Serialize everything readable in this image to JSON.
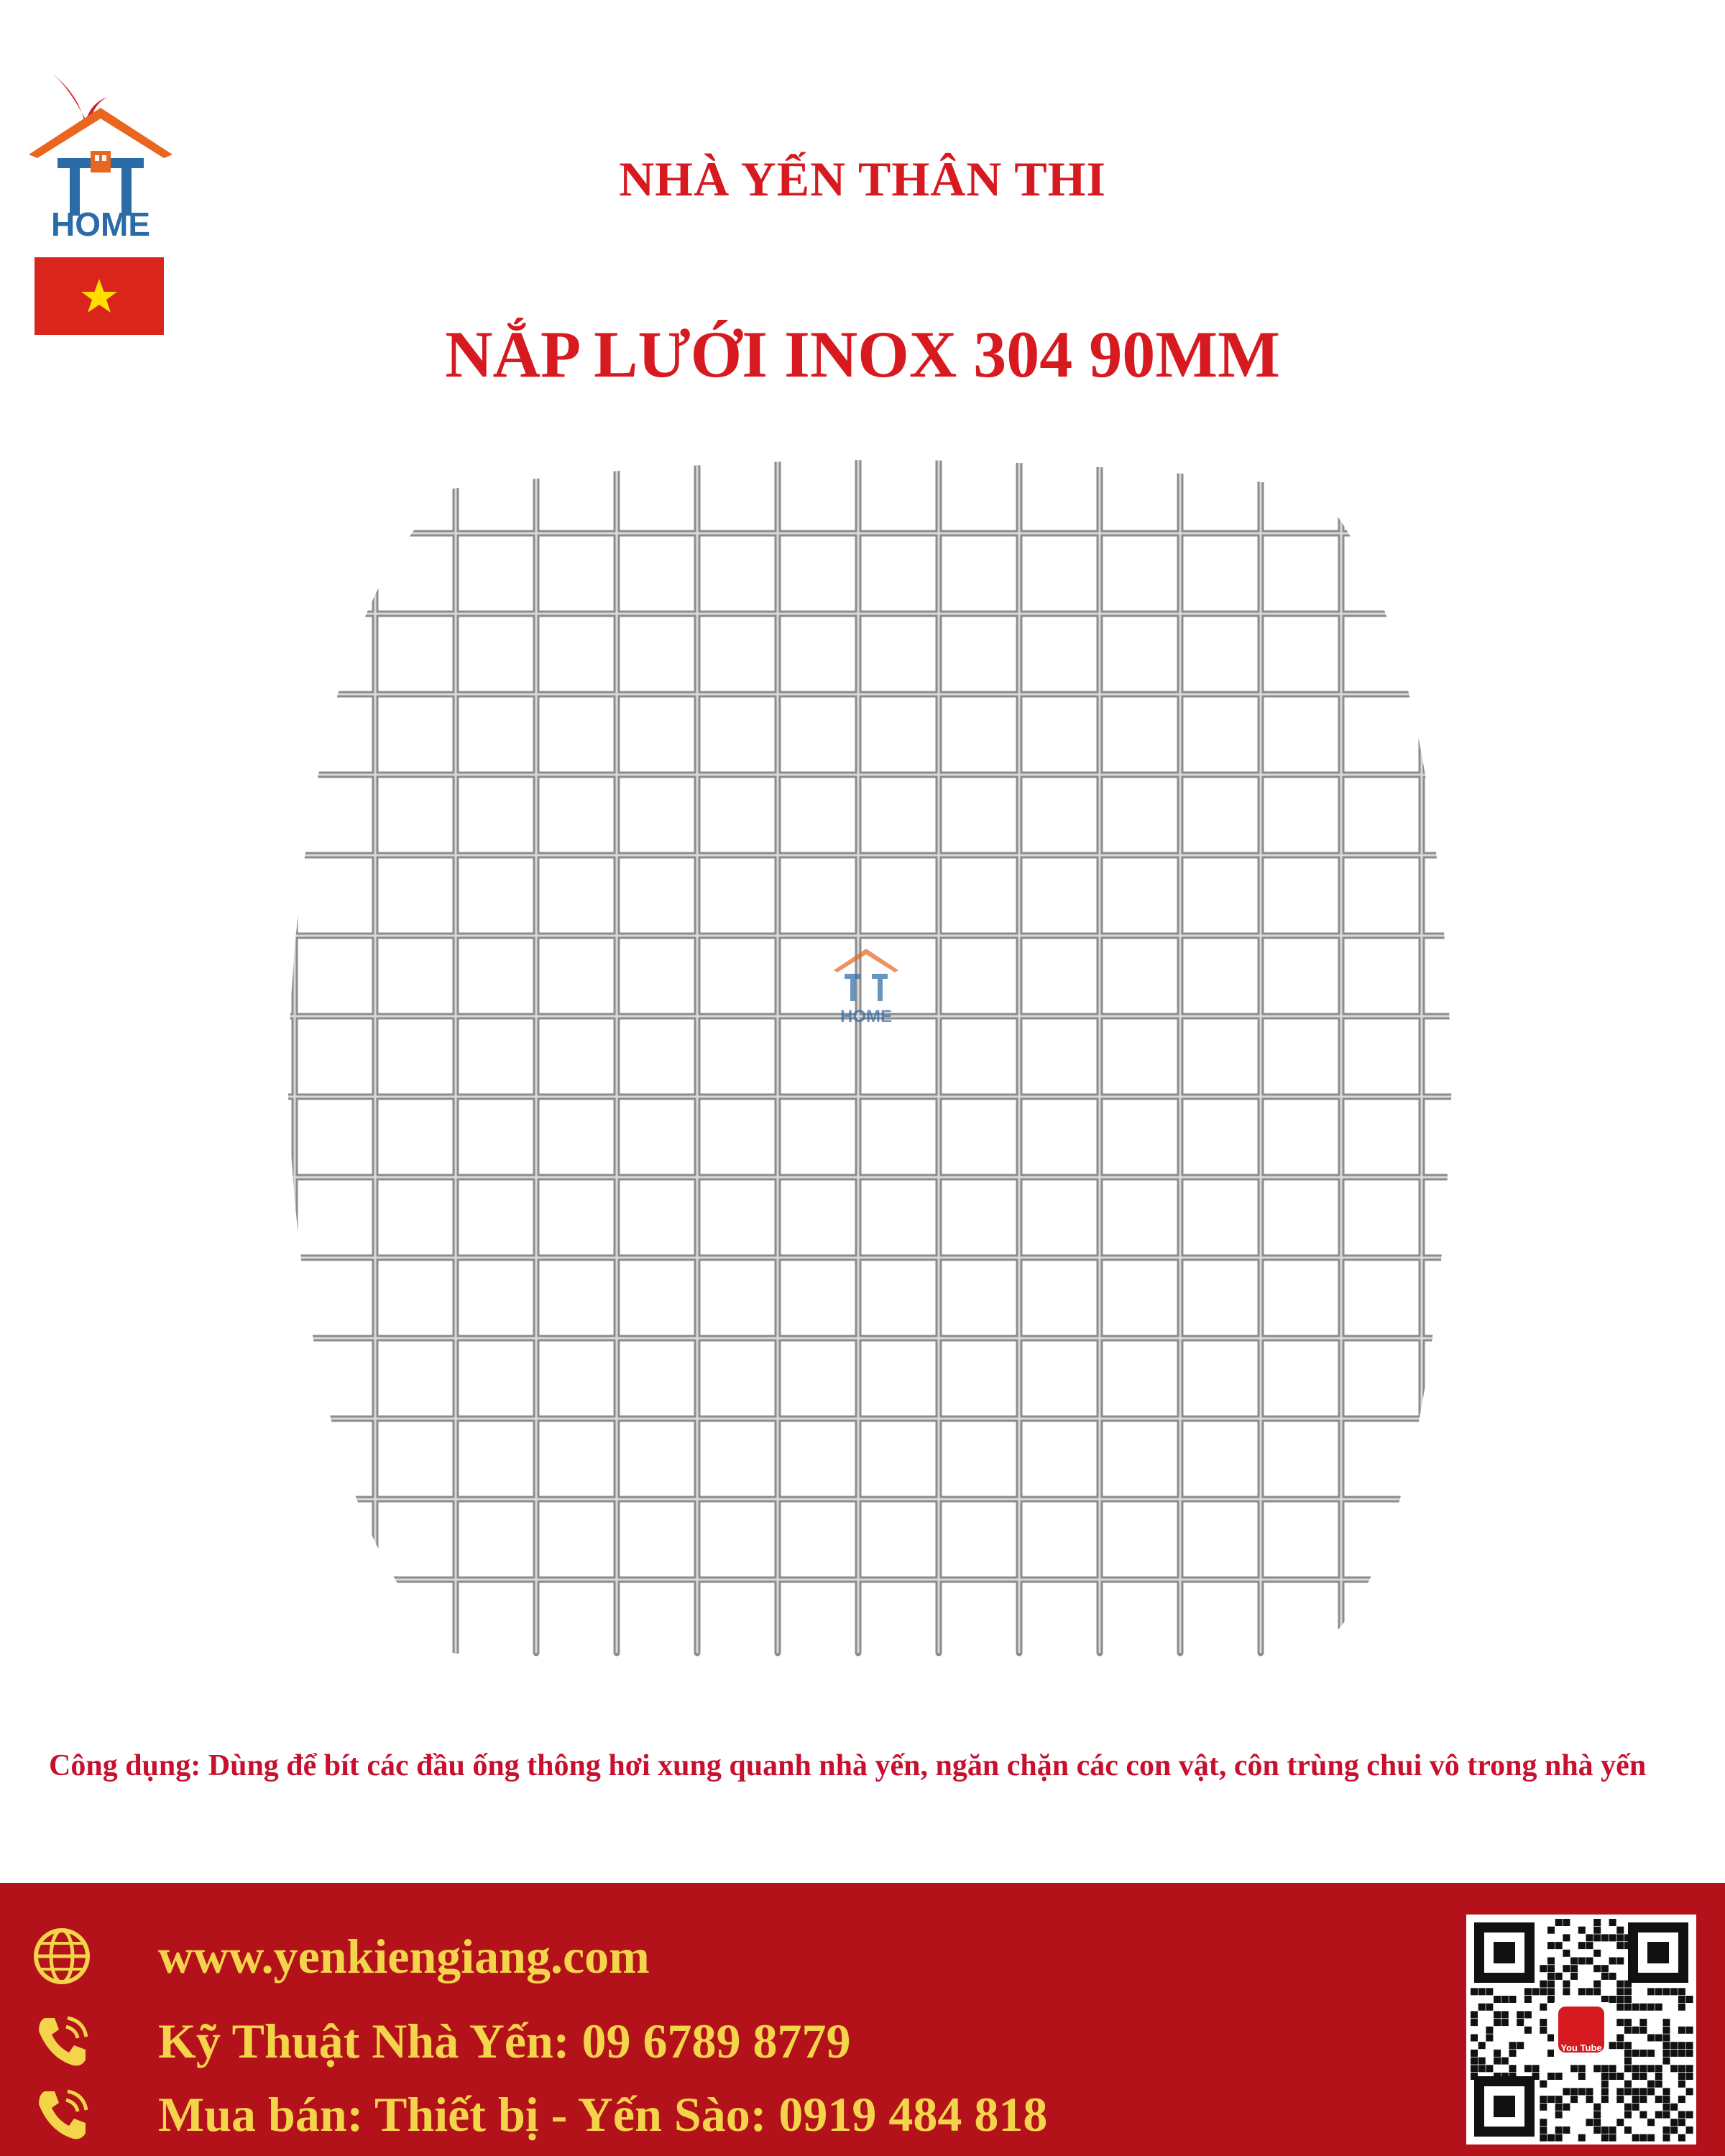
{
  "header": {
    "brand_title": "NHÀ YẾN THÂN THI",
    "product_title": "NẮP LƯỚI INOX 304 90MM",
    "logo": {
      "text": "HOME",
      "icon": "tt-home-logo",
      "colors": {
        "roof": "#e8661e",
        "house": "#2a6ba8",
        "bird": "#d71920"
      }
    },
    "flag": {
      "icon": "vietnam-flag",
      "colors": {
        "field": "#da251d",
        "star": "#ffde00"
      }
    }
  },
  "product_image": {
    "icon": "stainless-mesh-cover",
    "watermark_text": "HOME"
  },
  "usage": {
    "text": "Công dụng: Dùng để bít các đầu ống thông hơi xung quanh nhà yến, ngăn chặn các con vật, côn trùng chui vô trong nhà yến"
  },
  "footer": {
    "background": "#b3121b",
    "text_color": "#f4d44a",
    "website": "www.yenkiengiang.com",
    "technical": "Kỹ Thuật Nhà Yến: 09 6789 8779",
    "sales": "Mua bán: Thiết bị - Yến Sào: 0919 484 818",
    "icons": [
      "globe-icon",
      "phone-icon",
      "phone-icon"
    ],
    "qr": {
      "icon": "qr-code",
      "badge_text": "You Tube"
    }
  }
}
